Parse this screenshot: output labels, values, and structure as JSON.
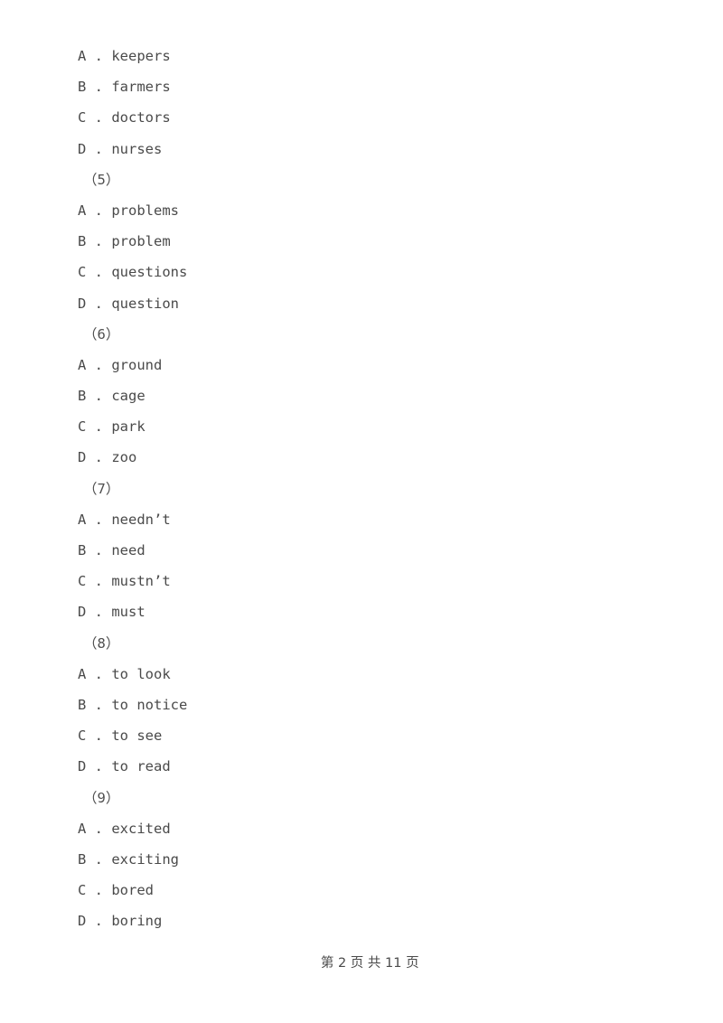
{
  "document": {
    "lines": [
      {
        "kind": "option",
        "text": "A . keepers"
      },
      {
        "kind": "option",
        "text": "B . farmers"
      },
      {
        "kind": "option",
        "text": "C . doctors"
      },
      {
        "kind": "option",
        "text": "D . nurses"
      },
      {
        "kind": "group-marker",
        "text": "（5）"
      },
      {
        "kind": "option",
        "text": "A . problems"
      },
      {
        "kind": "option",
        "text": "B . problem"
      },
      {
        "kind": "option",
        "text": "C . questions"
      },
      {
        "kind": "option",
        "text": "D . question"
      },
      {
        "kind": "group-marker",
        "text": "（6）"
      },
      {
        "kind": "option",
        "text": "A . ground"
      },
      {
        "kind": "option",
        "text": "B . cage"
      },
      {
        "kind": "option",
        "text": "C . park"
      },
      {
        "kind": "option",
        "text": "D . zoo"
      },
      {
        "kind": "group-marker",
        "text": "（7）"
      },
      {
        "kind": "option",
        "text": "A . needn’t"
      },
      {
        "kind": "option",
        "text": "B . need"
      },
      {
        "kind": "option",
        "text": "C . mustn’t"
      },
      {
        "kind": "option",
        "text": "D . must"
      },
      {
        "kind": "group-marker",
        "text": "（8）"
      },
      {
        "kind": "option",
        "text": "A . to look"
      },
      {
        "kind": "option",
        "text": "B . to notice"
      },
      {
        "kind": "option",
        "text": "C . to see"
      },
      {
        "kind": "option",
        "text": "D . to read"
      },
      {
        "kind": "group-marker",
        "text": "（9）"
      },
      {
        "kind": "option",
        "text": "A . excited"
      },
      {
        "kind": "option",
        "text": "B . exciting"
      },
      {
        "kind": "option",
        "text": "C . bored"
      },
      {
        "kind": "option",
        "text": "D . boring"
      }
    ]
  },
  "footer": {
    "page_label": "第 2 页 共 11 页",
    "current_page": 2,
    "total_pages": 11
  },
  "colors": {
    "page_background": "#ffffff",
    "body_text": "#4a4a4a",
    "footer_text": "#4a4a4a"
  }
}
